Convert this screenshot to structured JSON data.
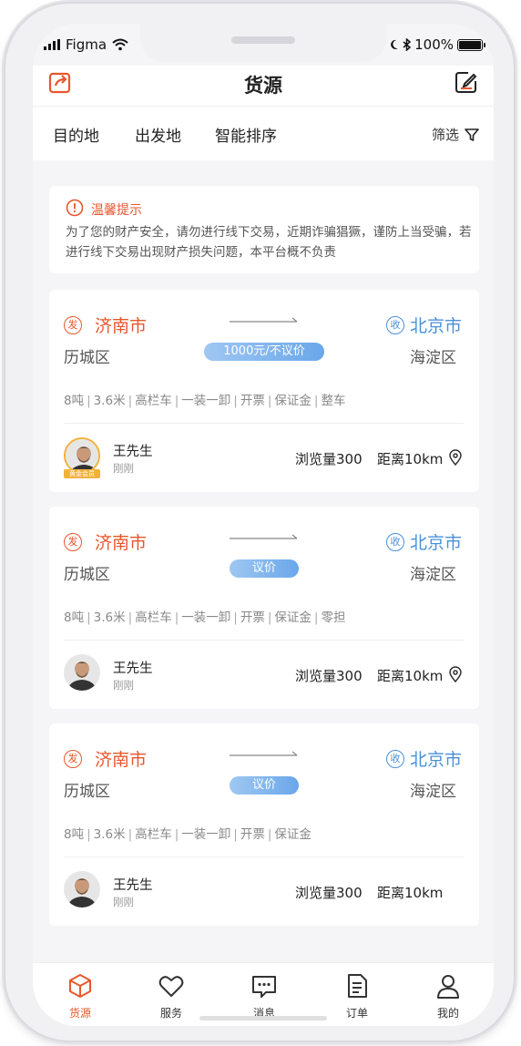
{
  "status": {
    "carrier": "Figma",
    "battery": "100%"
  },
  "header": {
    "title": "货源",
    "share_icon": "share-icon",
    "edit_icon": "edit-icon"
  },
  "filters": {
    "items": [
      "目的地",
      "出发地",
      "智能排序"
    ],
    "filter_label": "筛选"
  },
  "notice": {
    "title": "温馨提示",
    "text": "为了您的财产安全，请勿进行线下交易，近期诈骗猖獗，谨防上当受骗，若进行线下交易出现财产损失问题，本平台概不负责"
  },
  "cards": [
    {
      "from_badge": "发",
      "from_city": "济南市",
      "from_district": "历城区",
      "to_badge": "收",
      "to_city": "北京市",
      "to_district": "海淀区",
      "price": "1000元/不议价",
      "tags": [
        "8吨",
        "3.6米",
        "高栏车",
        "一装一卸",
        "开票",
        "保证金",
        "整车"
      ],
      "user": "王先生",
      "time": "刚刚",
      "vip": "黄金会员",
      "views": "浏览量300",
      "distance": "距离10km"
    },
    {
      "from_badge": "发",
      "from_city": "济南市",
      "from_district": "历城区",
      "to_badge": "收",
      "to_city": "北京市",
      "to_district": "海淀区",
      "price": "议价",
      "tags": [
        "8吨",
        "3.6米",
        "高栏车",
        "一装一卸",
        "开票",
        "保证金",
        "零担"
      ],
      "user": "王先生",
      "time": "刚刚",
      "views": "浏览量300",
      "distance": "距离10km"
    },
    {
      "from_badge": "发",
      "from_city": "济南市",
      "from_district": "历城区",
      "to_badge": "收",
      "to_city": "北京市",
      "to_district": "海淀区",
      "price": "议价",
      "tags": [
        "8吨",
        "3.6米",
        "高栏车",
        "一装一卸",
        "开票",
        "保证金"
      ],
      "user": "王先生",
      "time": "刚刚",
      "views": "浏览量300",
      "distance": "距离10km"
    }
  ],
  "tabs": [
    {
      "label": "货源",
      "icon": "box-icon",
      "active": true
    },
    {
      "label": "服务",
      "icon": "heart-icon",
      "active": false
    },
    {
      "label": "消息",
      "icon": "message-icon",
      "active": false
    },
    {
      "label": "订单",
      "icon": "order-icon",
      "active": false
    },
    {
      "label": "我的",
      "icon": "user-icon",
      "active": false
    }
  ],
  "colors": {
    "accent": "#e8572c",
    "blue": "#4a90d9",
    "gold": "#f2b23a"
  }
}
